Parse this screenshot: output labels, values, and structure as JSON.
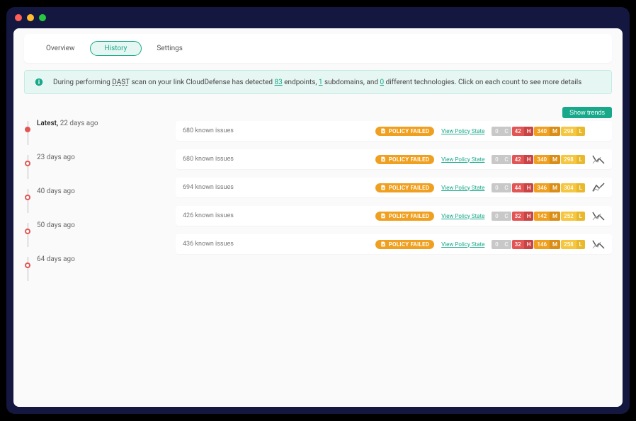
{
  "tabs": {
    "overview": "Overview",
    "history": "History",
    "settings": "Settings"
  },
  "banner": {
    "pre": "During performing ",
    "dast": "DAST",
    "mid1": " scan on your link CloudDefense has detected ",
    "endpoints": "83",
    "mid2": " endpoints, ",
    "subdomains": "1",
    "mid3": " subdomains, and ",
    "technologies": "0",
    "post": " different technologies. Click on each count to see more details"
  },
  "trendsBtn": "Show trends",
  "policy": "POLICY FAILED",
  "viewPolicy": "View Policy State",
  "sevLetters": {
    "c": "C",
    "h": "H",
    "m": "M",
    "l": "L"
  },
  "severityNone": "0",
  "timeline": [
    {
      "latest": true,
      "label_prefix": "Latest, ",
      "label": "22 days ago"
    },
    {
      "latest": false,
      "label_prefix": "",
      "label": "23 days ago"
    },
    {
      "latest": false,
      "label_prefix": "",
      "label": "40 days ago"
    },
    {
      "latest": false,
      "label_prefix": "",
      "label": "50 days ago"
    },
    {
      "latest": false,
      "label_prefix": "",
      "label": "64 days ago"
    }
  ],
  "rows": [
    {
      "issues": "680 known issues",
      "h": "42",
      "m": "340",
      "l": "298",
      "trend": "none"
    },
    {
      "issues": "680 known issues",
      "h": "42",
      "m": "340",
      "l": "298",
      "trend": "down"
    },
    {
      "issues": "694 known issues",
      "h": "44",
      "m": "346",
      "l": "304",
      "trend": "up"
    },
    {
      "issues": "426 known issues",
      "h": "32",
      "m": "142",
      "l": "252",
      "trend": "down"
    },
    {
      "issues": "436 known issues",
      "h": "32",
      "m": "146",
      "l": "258",
      "trend": "down"
    }
  ]
}
